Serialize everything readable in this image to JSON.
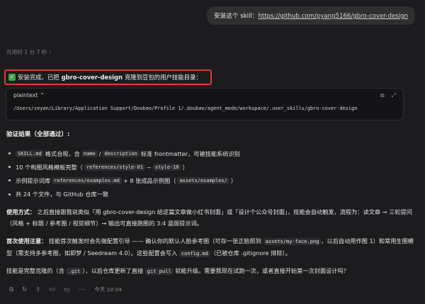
{
  "user_message": {
    "prefix": "安装这个 skill：",
    "link": "https://github.com/pyang5166/gbro-cover-design"
  },
  "elapsed": "共用时 1 分 7 秒",
  "done": {
    "prefix": "安装完成。已把 ",
    "name": "gbro-cover-design",
    "suffix": " 克隆到豆包的用户技能目录："
  },
  "code": {
    "lang": "plaintext",
    "content": "/Users/zeyan/Library/Application Support/Doubao/Profile 1/.doubao/agent_mode/workspace/.user_skills/gbro-cover-design"
  },
  "verify": {
    "title": "验证结果（全部通过）:",
    "items": [
      {
        "c1": "SKILL.md",
        "t1": " 格式合规，含 ",
        "c2": "name",
        "t2": " / ",
        "c3": "description",
        "t3": " 标准 frontmatter，可被技能系统识别"
      },
      {
        "t0": "10 个构图风格模板完整（",
        "c1": "references/style-01",
        "t1": " ~ ",
        "c2": "style-10",
        "t2": "）"
      },
      {
        "t0": "示例提示词库 ",
        "c1": "references/examples.md",
        "t1": " + 8 张成品示例图（",
        "c2": "assets/examples/",
        "t2": "）"
      },
      {
        "t0": "共 24 个文件，与 GitHub 仓库一致"
      }
    ]
  },
  "usage": {
    "label": "使用方式：",
    "text": " 之后直接跟我说类似「用 gbro-cover-design 给这篇文章做小红书封面」或「设计个公众号封面」，技能会自动触发，流程为：读文章 → 三轮提问（风格 + 标题 / 参考图 / 视觉细节）→ 输出可直接跑图的 3:4 竖版提示词。"
  },
  "first_use": {
    "label": "首次使用注意：",
    "t1": " 技能首次触发时会先做配置引导 —— 确认你的默认人脸参考图（可存一张正脸照到 ",
    "c1": "assets/my-face.png",
    "t2": "，以后自动用作图 1）和常用生图模型（需支持多参考图，如即梦 / Seedream 4.0）。这些配置会写入 ",
    "c2": "config.md",
    "t3": "（已被仓库 .gitignore 排除）。"
  },
  "closing": {
    "t1": "技能是完整克隆的（含 ",
    "c1": ".git",
    "t2": "），以后仓库更新了直接 ",
    "c2": "git pull",
    "t3": " 就能升级。需要我现在试跑一次，或者直接开始第一次封面设计吗？"
  },
  "footer": {
    "time": "今天 10:34"
  }
}
